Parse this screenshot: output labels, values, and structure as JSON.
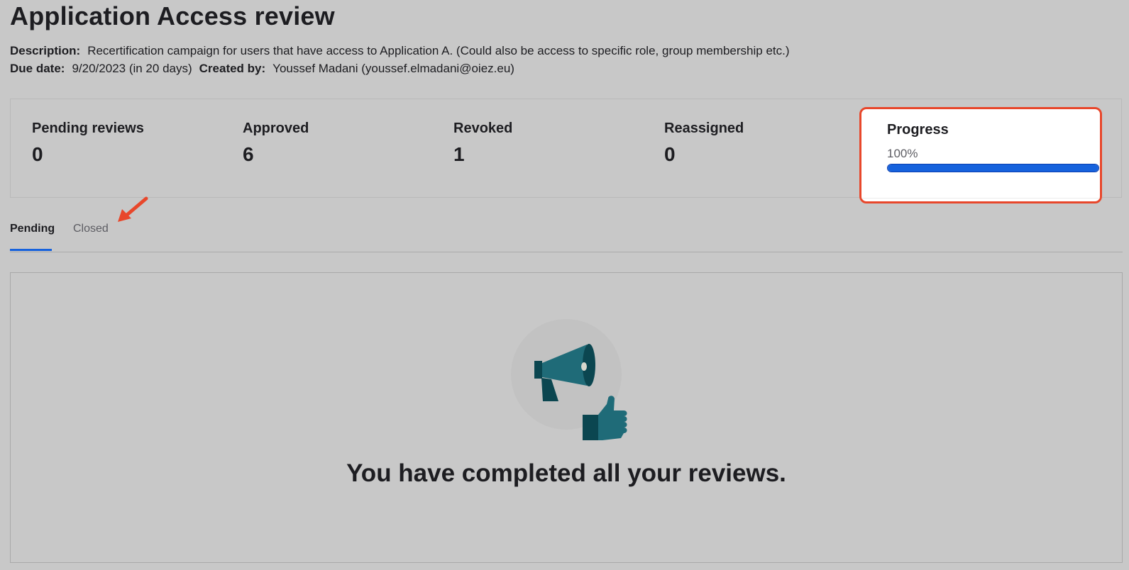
{
  "page": {
    "title": "Application Access review"
  },
  "meta": {
    "description_label": "Description:",
    "description_value": "Recertification campaign for users that have access to Application A. (Could also be access to specific role, group membership etc.)",
    "due_date_label": "Due date:",
    "due_date_value": "9/20/2023 (in 20 days)",
    "created_by_label": "Created by:",
    "created_by_value": "Youssef Madani (youssef.elmadani@oiez.eu)"
  },
  "stats": {
    "pending": {
      "label": "Pending reviews",
      "value": "0"
    },
    "approved": {
      "label": "Approved",
      "value": "6"
    },
    "revoked": {
      "label": "Revoked",
      "value": "1"
    },
    "reassigned": {
      "label": "Reassigned",
      "value": "0"
    },
    "progress": {
      "label": "Progress",
      "percent_text": "100%",
      "fraction": 1.0
    }
  },
  "tabs": {
    "pending": "Pending",
    "closed": "Closed",
    "active": "pending"
  },
  "empty_state": {
    "message": "You have completed all your reviews.",
    "icon": "megaphone-thumbs-up-illustration"
  },
  "colors": {
    "accent": "#1662dd",
    "annotation": "#e8472b",
    "illustration_teal": "#1f6b78",
    "illustration_dark": "#0b4650"
  }
}
